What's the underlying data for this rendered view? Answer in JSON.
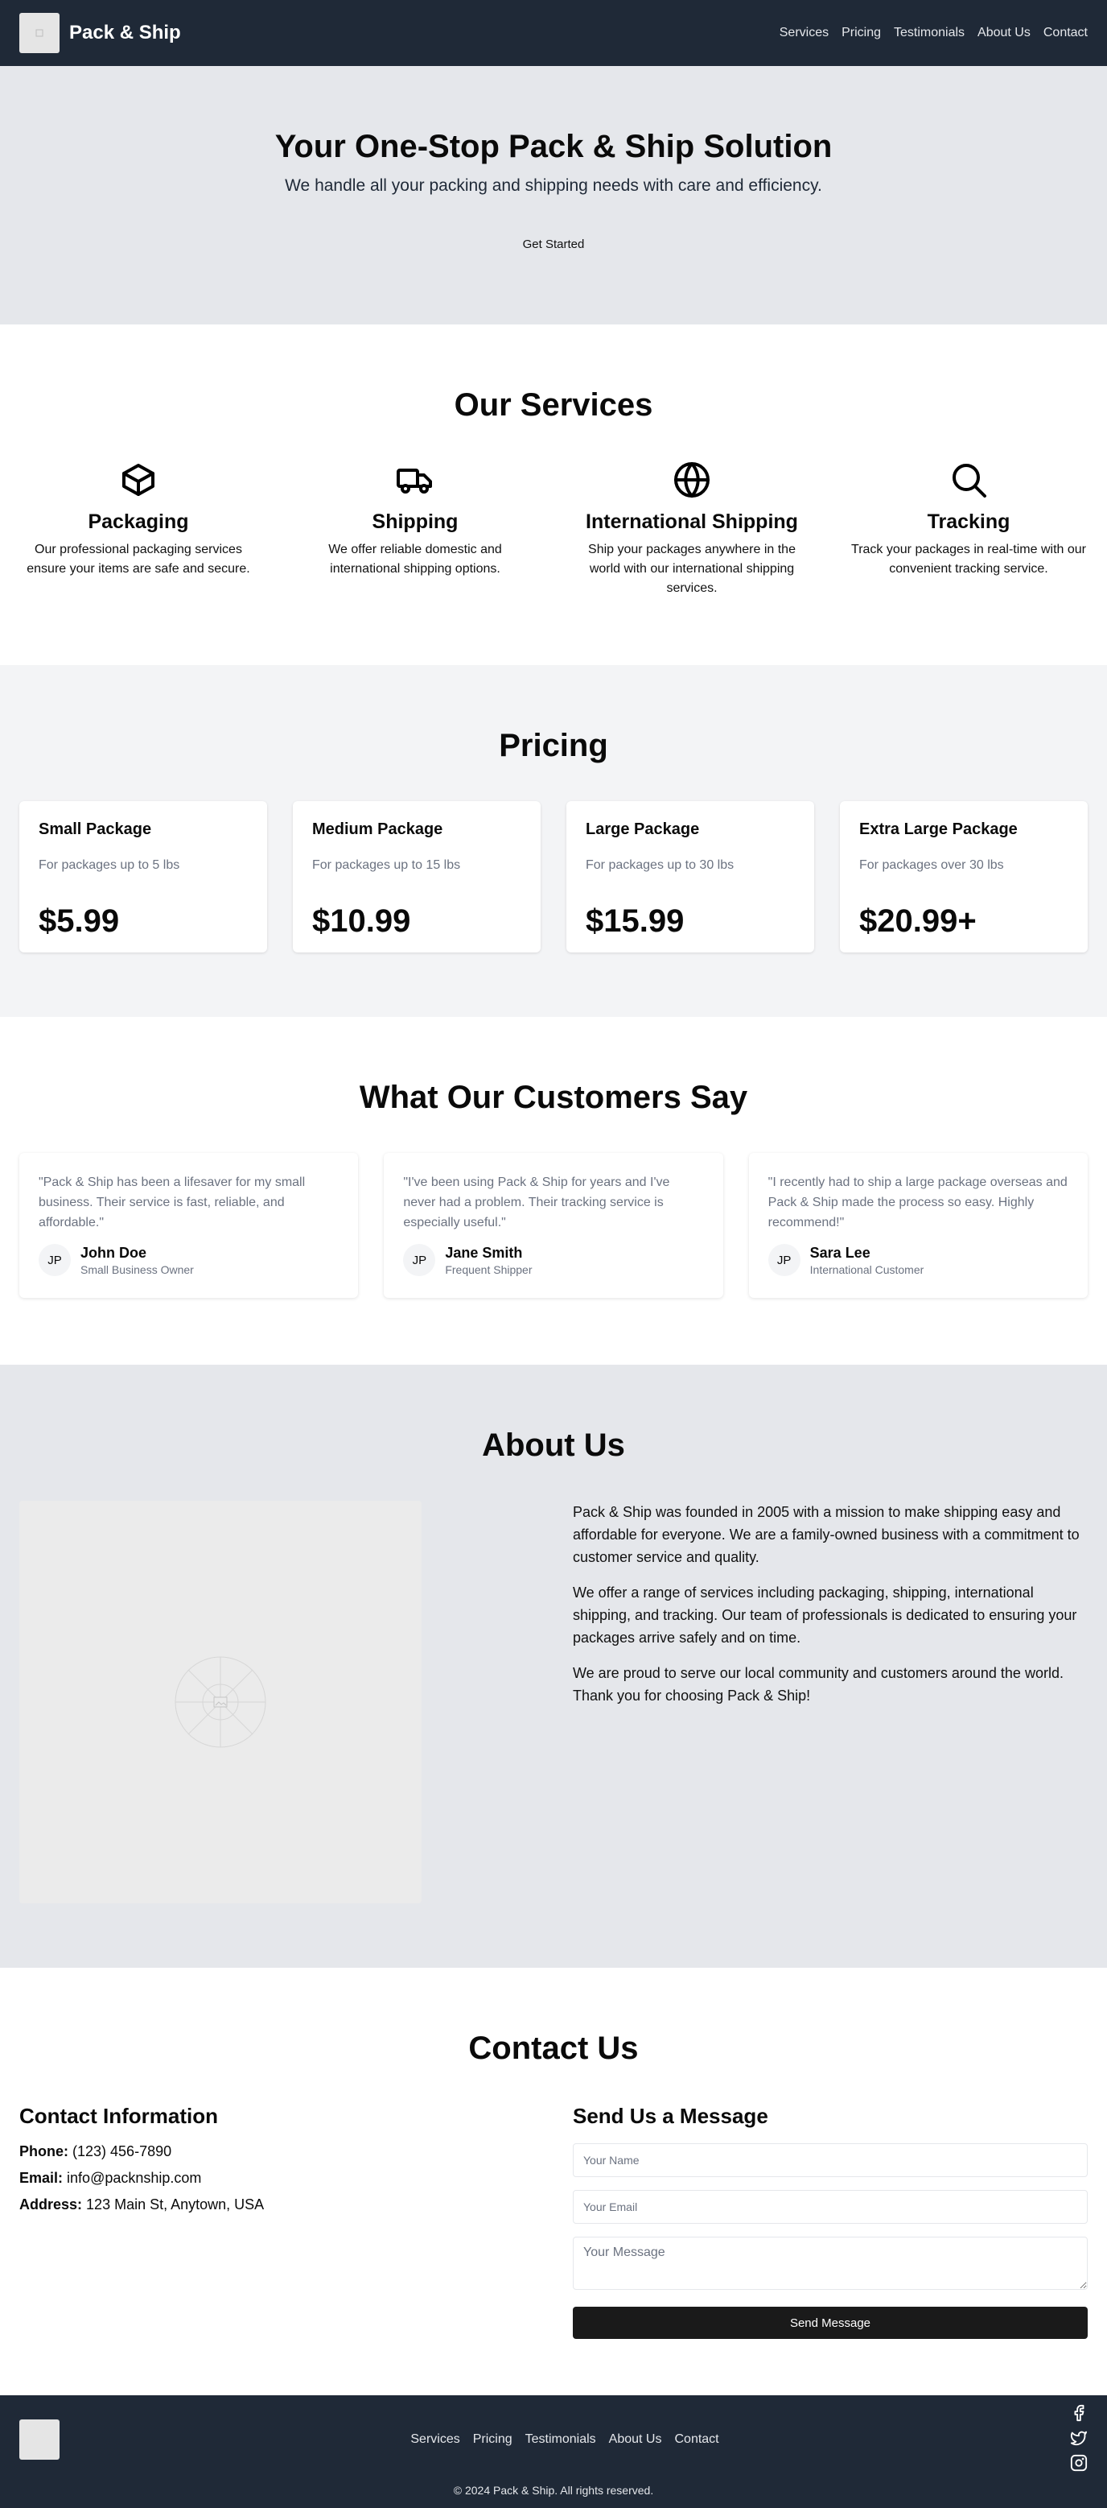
{
  "header": {
    "brand": "Pack & Ship",
    "nav": [
      "Services",
      "Pricing",
      "Testimonials",
      "About Us",
      "Contact"
    ]
  },
  "hero": {
    "title": "Your One-Stop Pack & Ship Solution",
    "subtitle": "We handle all your packing and shipping needs with care and efficiency.",
    "cta": "Get Started"
  },
  "services": {
    "title": "Our Services",
    "items": [
      {
        "icon": "box-icon",
        "title": "Packaging",
        "desc": "Our professional packaging services ensure your items are safe and secure."
      },
      {
        "icon": "truck-icon",
        "title": "Shipping",
        "desc": "We offer reliable domestic and international shipping options."
      },
      {
        "icon": "globe-icon",
        "title": "International Shipping",
        "desc": "Ship your packages anywhere in the world with our international shipping services."
      },
      {
        "icon": "search-icon",
        "title": "Tracking",
        "desc": "Track your packages in real-time with our convenient tracking service."
      }
    ]
  },
  "pricing": {
    "title": "Pricing",
    "plans": [
      {
        "name": "Small Package",
        "desc": "For packages up to 5 lbs",
        "price": "$5.99"
      },
      {
        "name": "Medium Package",
        "desc": "For packages up to 15 lbs",
        "price": "$10.99"
      },
      {
        "name": "Large Package",
        "desc": "For packages up to 30 lbs",
        "price": "$15.99"
      },
      {
        "name": "Extra Large Package",
        "desc": "For packages over 30 lbs",
        "price": "$20.99+"
      }
    ]
  },
  "testimonials": {
    "title": "What Our Customers Say",
    "items": [
      {
        "quote": "\"Pack & Ship has been a lifesaver for my small business. Their service is fast, reliable, and affordable.\"",
        "initials": "JP",
        "name": "John Doe",
        "role": "Small Business Owner"
      },
      {
        "quote": "\"I've been using Pack & Ship for years and I've never had a problem. Their tracking service is especially useful.\"",
        "initials": "JP",
        "name": "Jane Smith",
        "role": "Frequent Shipper"
      },
      {
        "quote": "\"I recently had to ship a large package overseas and Pack & Ship made the process so easy. Highly recommend!\"",
        "initials": "JP",
        "name": "Sara Lee",
        "role": "International Customer"
      }
    ]
  },
  "about": {
    "title": "About Us",
    "paragraphs": [
      "Pack & Ship was founded in 2005 with a mission to make shipping easy and affordable for everyone. We are a family-owned business with a commitment to customer service and quality.",
      "We offer a range of services including packaging, shipping, international shipping, and tracking. Our team of professionals is dedicated to ensuring your packages arrive safely and on time.",
      "We are proud to serve our local community and customers around the world. Thank you for choosing Pack & Ship!"
    ]
  },
  "contact": {
    "title": "Contact Us",
    "info_title": "Contact Information",
    "phone_label": "Phone:",
    "phone": "(123) 456-7890",
    "email_label": "Email:",
    "email": "info@packnship.com",
    "address_label": "Address:",
    "address": "123 Main St, Anytown, USA",
    "form_title": "Send Us a Message",
    "name_placeholder": "Your Name",
    "email_placeholder": "Your Email",
    "message_placeholder": "Your Message",
    "send": "Send Message"
  },
  "footer": {
    "nav": [
      "Services",
      "Pricing",
      "Testimonials",
      "About Us",
      "Contact"
    ],
    "social": [
      "facebook-icon",
      "twitter-icon",
      "instagram-icon"
    ],
    "copyright": "© 2024 Pack & Ship. All rights reserved."
  },
  "colors": {
    "dark": "#1f2937",
    "hero_bg": "#e5e7eb",
    "pricing_bg": "#f3f4f6",
    "button": "#1a1a1a"
  }
}
